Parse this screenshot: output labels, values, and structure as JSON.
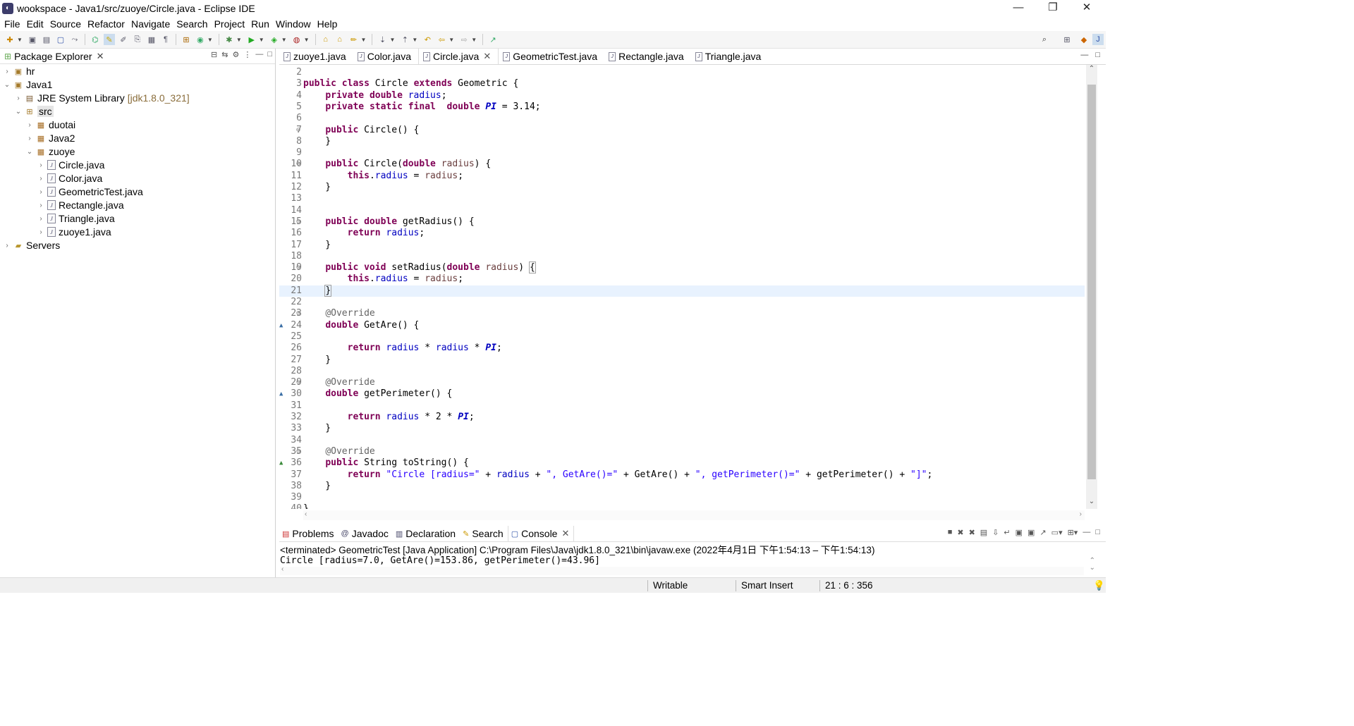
{
  "window": {
    "title": "wookspace - Java1/src/zuoye/Circle.java - Eclipse IDE",
    "controls": {
      "minimize": "—",
      "restore": "❐",
      "close": "✕"
    }
  },
  "menu": [
    "File",
    "Edit",
    "Source",
    "Refactor",
    "Navigate",
    "Search",
    "Project",
    "Run",
    "Window",
    "Help"
  ],
  "package_explorer": {
    "title": "Package Explorer",
    "tree": [
      {
        "label": "hr",
        "decor": "",
        "icon": "project-icon"
      },
      {
        "label": "Java1",
        "decor": "",
        "icon": "project-icon"
      },
      {
        "label": "JRE System Library",
        "decor": "[jdk1.8.0_321]",
        "icon": "library-icon"
      },
      {
        "label": "src",
        "decor": "",
        "icon": "source-folder-icon"
      },
      {
        "label": "duotai",
        "decor": "",
        "icon": "package-icon"
      },
      {
        "label": "Java2",
        "decor": "",
        "icon": "package-icon"
      },
      {
        "label": "zuoye",
        "decor": "",
        "icon": "package-icon"
      },
      {
        "label": "Circle.java",
        "decor": "",
        "icon": "java-file-icon"
      },
      {
        "label": "Color.java",
        "decor": "",
        "icon": "java-file-icon"
      },
      {
        "label": "GeometricTest.java",
        "decor": "",
        "icon": "java-file-icon"
      },
      {
        "label": "Rectangle.java",
        "decor": "",
        "icon": "java-file-icon"
      },
      {
        "label": "Triangle.java",
        "decor": "",
        "icon": "java-file-icon"
      },
      {
        "label": "zuoye1.java",
        "decor": "",
        "icon": "java-file-icon"
      },
      {
        "label": "Servers",
        "decor": "",
        "icon": "folder-icon"
      }
    ]
  },
  "editor_tabs": [
    {
      "label": "zuoye1.java",
      "active": false
    },
    {
      "label": "Color.java",
      "active": false
    },
    {
      "label": "Circle.java",
      "active": true
    },
    {
      "label": "GeometricTest.java",
      "active": false
    },
    {
      "label": "Rectangle.java",
      "active": false
    },
    {
      "label": "Triangle.java",
      "active": false
    }
  ],
  "code": {
    "current_line": 21,
    "lines": [
      {
        "n": "2",
        "html": ""
      },
      {
        "n": "3",
        "html": "<span class=\"kw\">public</span> <span class=\"kw\">class</span> Circle <span class=\"kw\">extends</span> Geometric {"
      },
      {
        "n": "4",
        "html": "    <span class=\"kw\">private</span> <span class=\"kw\">double</span> <span class=\"fld\">radius</span>;"
      },
      {
        "n": "5",
        "html": "    <span class=\"kw\">private</span> <span class=\"kw\">static</span> <span class=\"kw\">final</span>  <span class=\"kw\">double</span> <span class=\"sfld\">PI</span> = 3.14;"
      },
      {
        "n": "6",
        "html": ""
      },
      {
        "n": "7",
        "fold": true,
        "html": "    <span class=\"kw\">public</span> Circle() {"
      },
      {
        "n": "8",
        "html": "    }"
      },
      {
        "n": "9",
        "html": ""
      },
      {
        "n": "10",
        "fold": true,
        "html": "    <span class=\"kw\">public</span> Circle(<span class=\"kw\">double</span> <span class=\"par\">radius</span>) {"
      },
      {
        "n": "11",
        "html": "        <span class=\"kw\">this</span>.<span class=\"fld\">radius</span> = <span class=\"par\">radius</span>;"
      },
      {
        "n": "12",
        "html": "    }"
      },
      {
        "n": "13",
        "html": ""
      },
      {
        "n": "14",
        "html": ""
      },
      {
        "n": "15",
        "fold": true,
        "html": "    <span class=\"kw\">public</span> <span class=\"kw\">double</span> getRadius() {"
      },
      {
        "n": "16",
        "html": "        <span class=\"kw\">return</span> <span class=\"fld\">radius</span>;"
      },
      {
        "n": "17",
        "html": "    }"
      },
      {
        "n": "18",
        "html": ""
      },
      {
        "n": "19",
        "fold": true,
        "html": "    <span class=\"kw\">public</span> <span class=\"kw\">void</span> setRadius(<span class=\"kw\">double</span> <span class=\"par\">radius</span>) <span class=\"brk\">{</span>"
      },
      {
        "n": "20",
        "html": "        <span class=\"kw\">this</span>.<span class=\"fld\">radius</span> = <span class=\"par\">radius</span>;"
      },
      {
        "n": "21",
        "html": "    <span class=\"brk\">}</span><span class=\"caret\"></span>"
      },
      {
        "n": "22",
        "html": ""
      },
      {
        "n": "23",
        "fold": true,
        "html": "    <span class=\"ann\">@Override</span>"
      },
      {
        "n": "24",
        "ov": "override",
        "html": "    <span class=\"kw\">double</span> GetAre() {"
      },
      {
        "n": "25",
        "html": ""
      },
      {
        "n": "26",
        "html": "        <span class=\"kw\">return</span> <span class=\"fld\">radius</span> * <span class=\"fld\">radius</span> * <span class=\"sfld\">PI</span>;"
      },
      {
        "n": "27",
        "html": "    }"
      },
      {
        "n": "28",
        "html": ""
      },
      {
        "n": "29",
        "fold": true,
        "html": "    <span class=\"ann\">@Override</span>"
      },
      {
        "n": "30",
        "ov": "override",
        "html": "    <span class=\"kw\">double</span> getPerimeter() {"
      },
      {
        "n": "31",
        "html": ""
      },
      {
        "n": "32",
        "html": "        <span class=\"kw\">return</span> <span class=\"fld\">radius</span> * 2 * <span class=\"sfld\">PI</span>;"
      },
      {
        "n": "33",
        "html": "    }"
      },
      {
        "n": "34",
        "html": ""
      },
      {
        "n": "35",
        "fold": true,
        "html": "    <span class=\"ann\">@Override</span>"
      },
      {
        "n": "36",
        "ov": "implements",
        "html": "    <span class=\"kw\">public</span> String toString() {"
      },
      {
        "n": "37",
        "html": "        <span class=\"kw\">return</span> <span class=\"str\">\"Circle [radius=\"</span> + <span class=\"fld\">radius</span> + <span class=\"str\">\", GetAre()=\"</span> + GetAre() + <span class=\"str\">\", getPerimeter()=\"</span> + getPerimeter() + <span class=\"str\">\"]\"</span>;"
      },
      {
        "n": "38",
        "html": "    }"
      },
      {
        "n": "39",
        "html": ""
      },
      {
        "n": "40",
        "html": "}"
      }
    ]
  },
  "bottom_tabs": [
    {
      "label": "Problems",
      "icon": "problems-icon",
      "active": false
    },
    {
      "label": "Javadoc",
      "icon": "javadoc-icon",
      "active": false
    },
    {
      "label": "Declaration",
      "icon": "declaration-icon",
      "active": false
    },
    {
      "label": "Search",
      "icon": "search-icon",
      "active": false
    },
    {
      "label": "Console",
      "icon": "console-icon",
      "active": true
    }
  ],
  "console": {
    "terminated": "<terminated> GeometricTest [Java Application] C:\\Program Files\\Java\\jdk1.8.0_321\\bin\\javaw.exe  (2022年4月1日 下午1:54:13 – 下午1:54:13)",
    "output": "Circle [radius=7.0, GetAre()=153.86, getPerimeter()=43.96]"
  },
  "status": {
    "writable": "Writable",
    "insert_mode": "Smart Insert",
    "position": "21 : 6 : 356"
  },
  "colors": {
    "keyword": "#7f0055",
    "field": "#0000c0",
    "string": "#2a00ff",
    "annotation": "#646464",
    "current_line": "#e8f2fe"
  }
}
